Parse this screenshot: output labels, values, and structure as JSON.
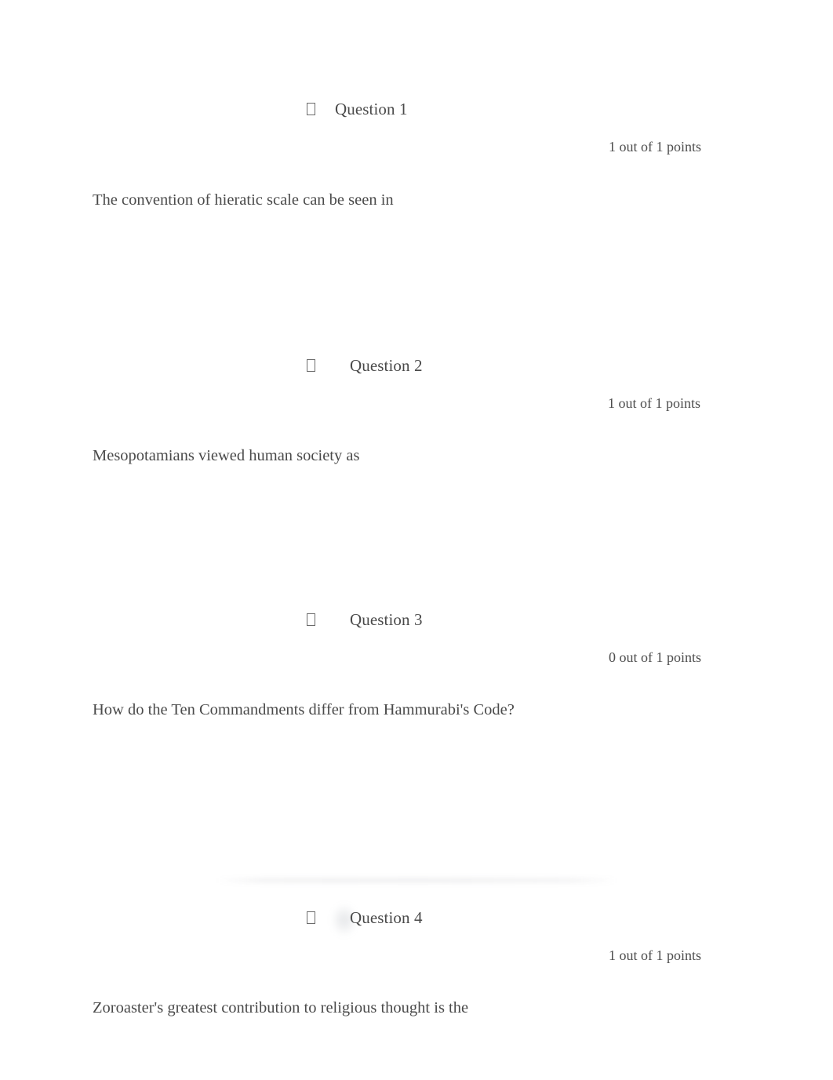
{
  "document": {
    "title": "Quiz Review",
    "background_color": "#ffffff",
    "text_color": "#474747"
  },
  "marker_icon": "missing-glyph-box-icon",
  "questions": [
    {
      "label": "Question 1",
      "points": "1 out of 1 points",
      "text": "The convention of hieratic scale can be seen in"
    },
    {
      "label": "Question 2",
      "points": "1 out of 1 points",
      "text": "Mesopotamians viewed human society as"
    },
    {
      "label": "Question 3",
      "points": "0 out of 1 points",
      "text": "How do the Ten Commandments differ from Hammurabi's Code?"
    },
    {
      "label": "Question 4",
      "points": "1 out of 1 points",
      "text": "Zoroaster's greatest contribution to religious thought is the"
    }
  ]
}
